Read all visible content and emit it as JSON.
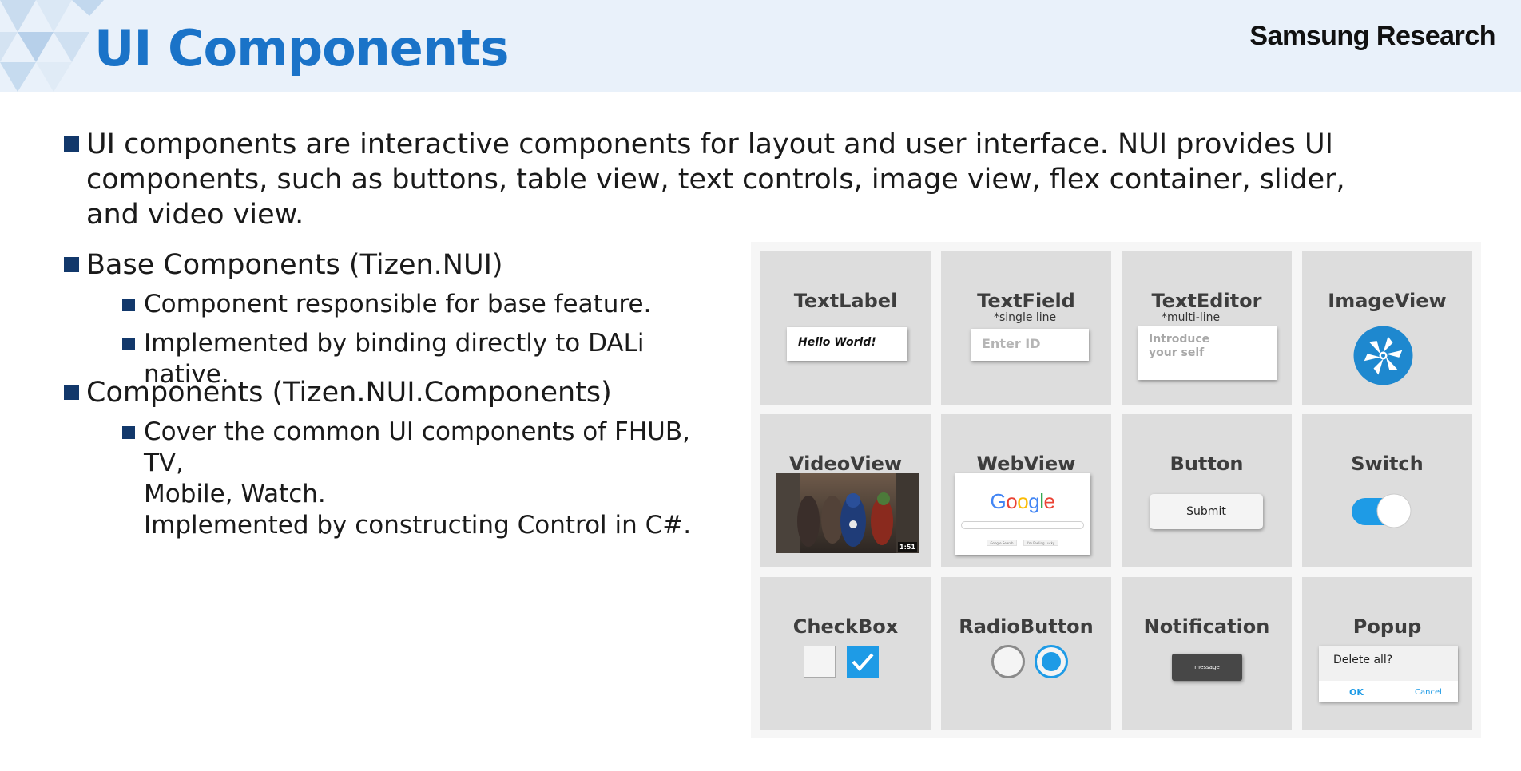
{
  "header": {
    "title": "UI Components",
    "brand": "Samsung Research"
  },
  "bullets": {
    "intro": "UI components are interactive components for layout and user interface. NUI provides UI components, such as buttons, table view, text controls, image view, flex container, slider, and video view.",
    "base_title": "Base Components (Tizen.NUI)",
    "base_items": [
      "Component responsible for base feature.",
      "Implemented by binding directly to DALi native."
    ],
    "comp_title": "Components (Tizen.NUI.Components)",
    "comp_items": [
      "Cover the common UI components of FHUB, TV,\nMobile, Watch.\nImplemented by constructing Control in C#."
    ]
  },
  "grid": {
    "textlabel": {
      "title": "TextLabel",
      "value": "Hello World!"
    },
    "textfield": {
      "title": "TextField",
      "note": "*single line",
      "placeholder": "Enter ID"
    },
    "texteditor": {
      "title": "TextEditor",
      "note": "*multi-line",
      "placeholder": "Introduce\nyour self"
    },
    "imageview": {
      "title": "ImageView",
      "icon": "tizen-pinwheel-icon"
    },
    "videoview": {
      "title": "VideoView",
      "duration": "1:51"
    },
    "webview": {
      "title": "WebView",
      "logo": "Google",
      "search_btn": "Google Search",
      "lucky_btn": "I'm Feeling Lucky"
    },
    "button": {
      "title": "Button",
      "label": "Submit"
    },
    "switch": {
      "title": "Switch",
      "state": "on"
    },
    "checkbox": {
      "title": "CheckBox"
    },
    "radiobutton": {
      "title": "RadioButton"
    },
    "notification": {
      "title": "Notification",
      "message": "message"
    },
    "popup": {
      "title": "Popup",
      "message": "Delete all?",
      "ok": "OK",
      "cancel": "Cancel"
    }
  },
  "colors": {
    "accent": "#1a73c8",
    "bullet": "#12386b",
    "active_blue": "#1e9be6",
    "header_bg": "#e9f1fa"
  }
}
